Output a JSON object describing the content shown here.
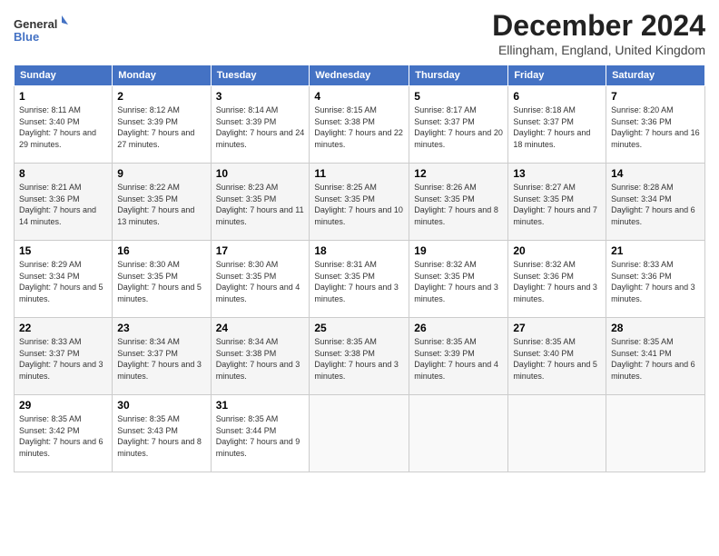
{
  "header": {
    "logo_line1": "General",
    "logo_line2": "Blue",
    "title": "December 2024",
    "subtitle": "Ellingham, England, United Kingdom"
  },
  "columns": [
    "Sunday",
    "Monday",
    "Tuesday",
    "Wednesday",
    "Thursday",
    "Friday",
    "Saturday"
  ],
  "weeks": [
    [
      {
        "day": "1",
        "sunrise": "8:11 AM",
        "sunset": "3:40 PM",
        "daylight": "7 hours and 29 minutes."
      },
      {
        "day": "2",
        "sunrise": "8:12 AM",
        "sunset": "3:39 PM",
        "daylight": "7 hours and 27 minutes."
      },
      {
        "day": "3",
        "sunrise": "8:14 AM",
        "sunset": "3:39 PM",
        "daylight": "7 hours and 24 minutes."
      },
      {
        "day": "4",
        "sunrise": "8:15 AM",
        "sunset": "3:38 PM",
        "daylight": "7 hours and 22 minutes."
      },
      {
        "day": "5",
        "sunrise": "8:17 AM",
        "sunset": "3:37 PM",
        "daylight": "7 hours and 20 minutes."
      },
      {
        "day": "6",
        "sunrise": "8:18 AM",
        "sunset": "3:37 PM",
        "daylight": "7 hours and 18 minutes."
      },
      {
        "day": "7",
        "sunrise": "8:20 AM",
        "sunset": "3:36 PM",
        "daylight": "7 hours and 16 minutes."
      }
    ],
    [
      {
        "day": "8",
        "sunrise": "8:21 AM",
        "sunset": "3:36 PM",
        "daylight": "7 hours and 14 minutes."
      },
      {
        "day": "9",
        "sunrise": "8:22 AM",
        "sunset": "3:35 PM",
        "daylight": "7 hours and 13 minutes."
      },
      {
        "day": "10",
        "sunrise": "8:23 AM",
        "sunset": "3:35 PM",
        "daylight": "7 hours and 11 minutes."
      },
      {
        "day": "11",
        "sunrise": "8:25 AM",
        "sunset": "3:35 PM",
        "daylight": "7 hours and 10 minutes."
      },
      {
        "day": "12",
        "sunrise": "8:26 AM",
        "sunset": "3:35 PM",
        "daylight": "7 hours and 8 minutes."
      },
      {
        "day": "13",
        "sunrise": "8:27 AM",
        "sunset": "3:35 PM",
        "daylight": "7 hours and 7 minutes."
      },
      {
        "day": "14",
        "sunrise": "8:28 AM",
        "sunset": "3:34 PM",
        "daylight": "7 hours and 6 minutes."
      }
    ],
    [
      {
        "day": "15",
        "sunrise": "8:29 AM",
        "sunset": "3:34 PM",
        "daylight": "7 hours and 5 minutes."
      },
      {
        "day": "16",
        "sunrise": "8:30 AM",
        "sunset": "3:35 PM",
        "daylight": "7 hours and 5 minutes."
      },
      {
        "day": "17",
        "sunrise": "8:30 AM",
        "sunset": "3:35 PM",
        "daylight": "7 hours and 4 minutes."
      },
      {
        "day": "18",
        "sunrise": "8:31 AM",
        "sunset": "3:35 PM",
        "daylight": "7 hours and 3 minutes."
      },
      {
        "day": "19",
        "sunrise": "8:32 AM",
        "sunset": "3:35 PM",
        "daylight": "7 hours and 3 minutes."
      },
      {
        "day": "20",
        "sunrise": "8:32 AM",
        "sunset": "3:36 PM",
        "daylight": "7 hours and 3 minutes."
      },
      {
        "day": "21",
        "sunrise": "8:33 AM",
        "sunset": "3:36 PM",
        "daylight": "7 hours and 3 minutes."
      }
    ],
    [
      {
        "day": "22",
        "sunrise": "8:33 AM",
        "sunset": "3:37 PM",
        "daylight": "7 hours and 3 minutes."
      },
      {
        "day": "23",
        "sunrise": "8:34 AM",
        "sunset": "3:37 PM",
        "daylight": "7 hours and 3 minutes."
      },
      {
        "day": "24",
        "sunrise": "8:34 AM",
        "sunset": "3:38 PM",
        "daylight": "7 hours and 3 minutes."
      },
      {
        "day": "25",
        "sunrise": "8:35 AM",
        "sunset": "3:38 PM",
        "daylight": "7 hours and 3 minutes."
      },
      {
        "day": "26",
        "sunrise": "8:35 AM",
        "sunset": "3:39 PM",
        "daylight": "7 hours and 4 minutes."
      },
      {
        "day": "27",
        "sunrise": "8:35 AM",
        "sunset": "3:40 PM",
        "daylight": "7 hours and 5 minutes."
      },
      {
        "day": "28",
        "sunrise": "8:35 AM",
        "sunset": "3:41 PM",
        "daylight": "7 hours and 6 minutes."
      }
    ],
    [
      {
        "day": "29",
        "sunrise": "8:35 AM",
        "sunset": "3:42 PM",
        "daylight": "7 hours and 6 minutes."
      },
      {
        "day": "30",
        "sunrise": "8:35 AM",
        "sunset": "3:43 PM",
        "daylight": "7 hours and 8 minutes."
      },
      {
        "day": "31",
        "sunrise": "8:35 AM",
        "sunset": "3:44 PM",
        "daylight": "7 hours and 9 minutes."
      },
      null,
      null,
      null,
      null
    ]
  ],
  "labels": {
    "sunrise": "Sunrise:",
    "sunset": "Sunset:",
    "daylight": "Daylight:"
  }
}
